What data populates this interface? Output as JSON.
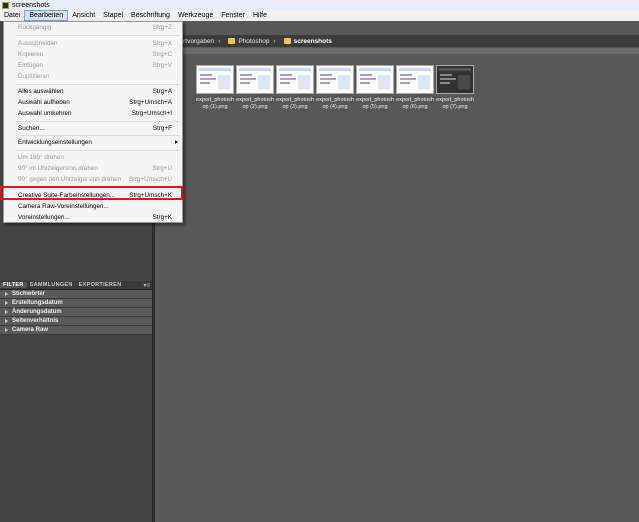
{
  "window": {
    "title": "screenshots"
  },
  "menubar": [
    "Datei",
    "Bearbeiten",
    "Ansicht",
    "Stapel",
    "Beschriftung",
    "Werkzeuge",
    "Fenster",
    "Hilfe"
  ],
  "path": {
    "items": [
      "exportvorgaben",
      "Photoshop",
      "screenshots"
    ]
  },
  "thumbnails": [
    {
      "name": "export_photosh\nop (1).png"
    },
    {
      "name": "export_photosh\nop (2).png"
    },
    {
      "name": "export_photosh\nop (3).png"
    },
    {
      "name": "export_photosh\nop (4).png"
    },
    {
      "name": "export_photosh\nop (5).png"
    },
    {
      "name": "export_photosh\nop (6).png"
    },
    {
      "name": "export_photosh\nop (7).png"
    }
  ],
  "edit_menu": {
    "items": [
      {
        "label": "Rückgängig",
        "shortcut": "Strg+Z",
        "disabled": true
      },
      {
        "label": "Ausschneiden",
        "shortcut": "Strg+X",
        "disabled": true
      },
      {
        "label": "Kopieren",
        "shortcut": "Strg+C",
        "disabled": true
      },
      {
        "label": "Einfügen",
        "shortcut": "Strg+V",
        "disabled": true
      },
      {
        "label": "Duplizieren",
        "shortcut": "",
        "disabled": true
      },
      {
        "label": "Alles auswählen",
        "shortcut": "Strg+A",
        "disabled": false
      },
      {
        "label": "Auswahl aufheben",
        "shortcut": "Strg+Umsch+A",
        "disabled": false
      },
      {
        "label": "Auswahl umkehren",
        "shortcut": "Strg+Umsch+I",
        "disabled": false
      },
      {
        "label": "Suchen...",
        "shortcut": "Strg+F",
        "disabled": false
      },
      {
        "label": "Entwicklungseinstellungen",
        "shortcut": "",
        "disabled": false,
        "submenu": true
      },
      {
        "label": "Um 180° drehen",
        "shortcut": "",
        "disabled": true
      },
      {
        "label": "90° im Uhrzeigersinn drehen",
        "shortcut": "Strg+U",
        "disabled": true
      },
      {
        "label": "90° gegen den Uhrzeigersinn drehen",
        "shortcut": "Strg+Umsch+U",
        "disabled": true
      },
      {
        "label": "Creative Suite-Farbeinstellungen...",
        "shortcut": "Strg+Umsch+K",
        "disabled": false
      },
      {
        "label": "Camera Raw-Voreinstellungen...",
        "shortcut": "",
        "disabled": false
      },
      {
        "label": "Voreinstellungen...",
        "shortcut": "Strg+K",
        "disabled": false
      }
    ]
  },
  "filter_panel": {
    "tabs": [
      "FILTER",
      "SAMMLUNGEN",
      "EXPORTIEREN"
    ],
    "rows": [
      "Stichwörter",
      "Erstellungsdatum",
      "Änderungsdatum",
      "Seitenverhältnis",
      "Camera Raw"
    ]
  }
}
